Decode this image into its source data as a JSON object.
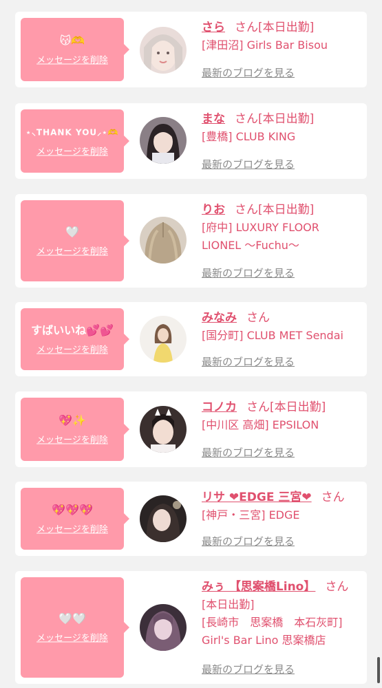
{
  "colors": {
    "accent": "#e0506e",
    "bubble": "#ff9aaa",
    "background": "#f2f2f2"
  },
  "common": {
    "delete_label": "メッセージを削除",
    "blog_label": "最新のブログを見る",
    "san": "さん"
  },
  "items": [
    {
      "message": "😽🫶",
      "name": "さら",
      "shift": "[本日出勤]",
      "shop": "[津田沼] Girls Bar Bisou",
      "avatar_icon": "avatar-photo"
    },
    {
      "message": "⋆⸜THANK YOU⸝⋆🫶",
      "name": "まな",
      "shift": "[本日出勤]",
      "shop": "[豊橋] CLUB KING",
      "avatar_icon": "avatar-photo"
    },
    {
      "message": "🤍",
      "name": "りお",
      "shift": "[本日出勤]",
      "shop": "[府中] LUXURY FLOOR LIONEL ～Fuchu～",
      "avatar_icon": "avatar-photo"
    },
    {
      "message": "すばいいね💕💕",
      "name": "みなみ",
      "shift": "",
      "shop": "[国分町] CLUB MET Sendai",
      "avatar_icon": "avatar-photo"
    },
    {
      "message": "💖✨",
      "name": "コノカ",
      "shift": "[本日出勤]",
      "shop": "[中川区 高畑] EPSILON",
      "avatar_icon": "avatar-photo"
    },
    {
      "message": "💖💖💖",
      "name": "リサ ❤EDGE 三宮❤",
      "shift": "",
      "shop": "[神戸・三宮] EDGE",
      "avatar_icon": "avatar-photo"
    },
    {
      "message": "🤍🤍",
      "name": "みぅ 【思案橋Lino】",
      "shift": "本日出勤]",
      "shift_prefix": "[",
      "shop": "[長崎市　思案橋　本石灰町] Girl's Bar Lino 思案橋店",
      "avatar_icon": "avatar-photo"
    }
  ]
}
